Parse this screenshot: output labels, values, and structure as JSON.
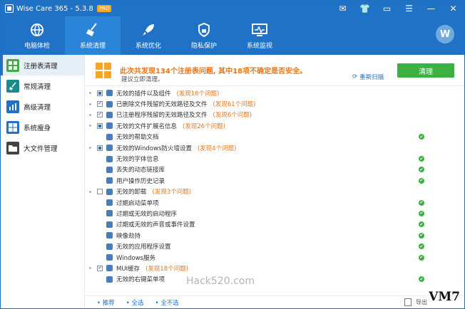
{
  "titlebar": {
    "app_title": "Wise Care 365 - 5.3.8",
    "badge": "PRO",
    "controls": [
      "mail-icon",
      "shirt-icon",
      "theme-icon",
      "menu-icon",
      "minimize-icon",
      "close-icon"
    ]
  },
  "nav": [
    {
      "label": "电脑体检",
      "icon": "globe-icon",
      "active": false
    },
    {
      "label": "系统清理",
      "icon": "broom-icon",
      "active": true
    },
    {
      "label": "系统优化",
      "icon": "rocket-icon",
      "active": false
    },
    {
      "label": "隐私保护",
      "icon": "lock-icon",
      "active": false
    },
    {
      "label": "系统监视",
      "icon": "monitor-icon",
      "active": false
    }
  ],
  "avatar_letter": "W",
  "sidebar": [
    {
      "label": "注册表清理",
      "icon": "registry-icon",
      "color": "#3cb043",
      "active": true
    },
    {
      "label": "常规清理",
      "icon": "brush-icon",
      "color": "#1a8a8a",
      "active": false
    },
    {
      "label": "高级清理",
      "icon": "chart-icon",
      "color": "#1f72c6",
      "active": false
    },
    {
      "label": "系统瘦身",
      "icon": "windows-icon",
      "color": "#1f72c6",
      "active": false
    },
    {
      "label": "大文件管理",
      "icon": "folder-icon",
      "color": "#444444",
      "active": false
    }
  ],
  "banner": {
    "message": "此次共发现134个注册表问题, 其中18项不确定是否安全。",
    "sub": "建议立即清理。",
    "rescan": "重新扫描",
    "clean_button": "清理"
  },
  "items": [
    {
      "label": "无效的插件以及组件",
      "found": "(发现16个问题)",
      "check": "part",
      "ok": false
    },
    {
      "label": "已删除文件残留的无效路径及文件",
      "found": "(发现61个问题)",
      "check": "on",
      "ok": false
    },
    {
      "label": "已注册程序残留的无效路径及文件",
      "found": "(发现6个问题)",
      "check": "on",
      "ok": false
    },
    {
      "label": "无效的文件扩展名信息",
      "found": "(发现26个问题)",
      "check": "part",
      "ok": false
    },
    {
      "label": "无效的帮助文档",
      "found": "",
      "check": "none",
      "ok": true
    },
    {
      "label": "无效的Windows防火墙设置",
      "found": "(发现4个问题)",
      "check": "part",
      "ok": false
    },
    {
      "label": "无效的字体信息",
      "found": "",
      "check": "none",
      "ok": true
    },
    {
      "label": "丢失的动态链接库",
      "found": "",
      "check": "none",
      "ok": true
    },
    {
      "label": "用户操作历史记录",
      "found": "",
      "check": "none",
      "ok": true
    },
    {
      "label": "无效的卸载",
      "found": "(发现3个问题)",
      "check": "off",
      "ok": false
    },
    {
      "label": "过期启动菜单项",
      "found": "",
      "check": "none",
      "ok": true
    },
    {
      "label": "过期或无效的启动程序",
      "found": "",
      "check": "none",
      "ok": true
    },
    {
      "label": "过期或无效的声音或事件设置",
      "found": "",
      "check": "none",
      "ok": true
    },
    {
      "label": "映像劫持",
      "found": "",
      "check": "none",
      "ok": true
    },
    {
      "label": "无效的应用程序设置",
      "found": "",
      "check": "none",
      "ok": true
    },
    {
      "label": "Windows服务",
      "found": "",
      "check": "none",
      "ok": true
    },
    {
      "label": "MUI缓存",
      "found": "(发现18个问题)",
      "check": "on",
      "ok": false
    },
    {
      "label": "无效的右键菜单项",
      "found": "",
      "check": "none",
      "ok": true
    }
  ],
  "footer": {
    "links": [
      "推荐",
      "全选",
      "全不选"
    ],
    "ext_label": "导出"
  },
  "watermark": "Hack520.com",
  "corner_mark": "VM7"
}
